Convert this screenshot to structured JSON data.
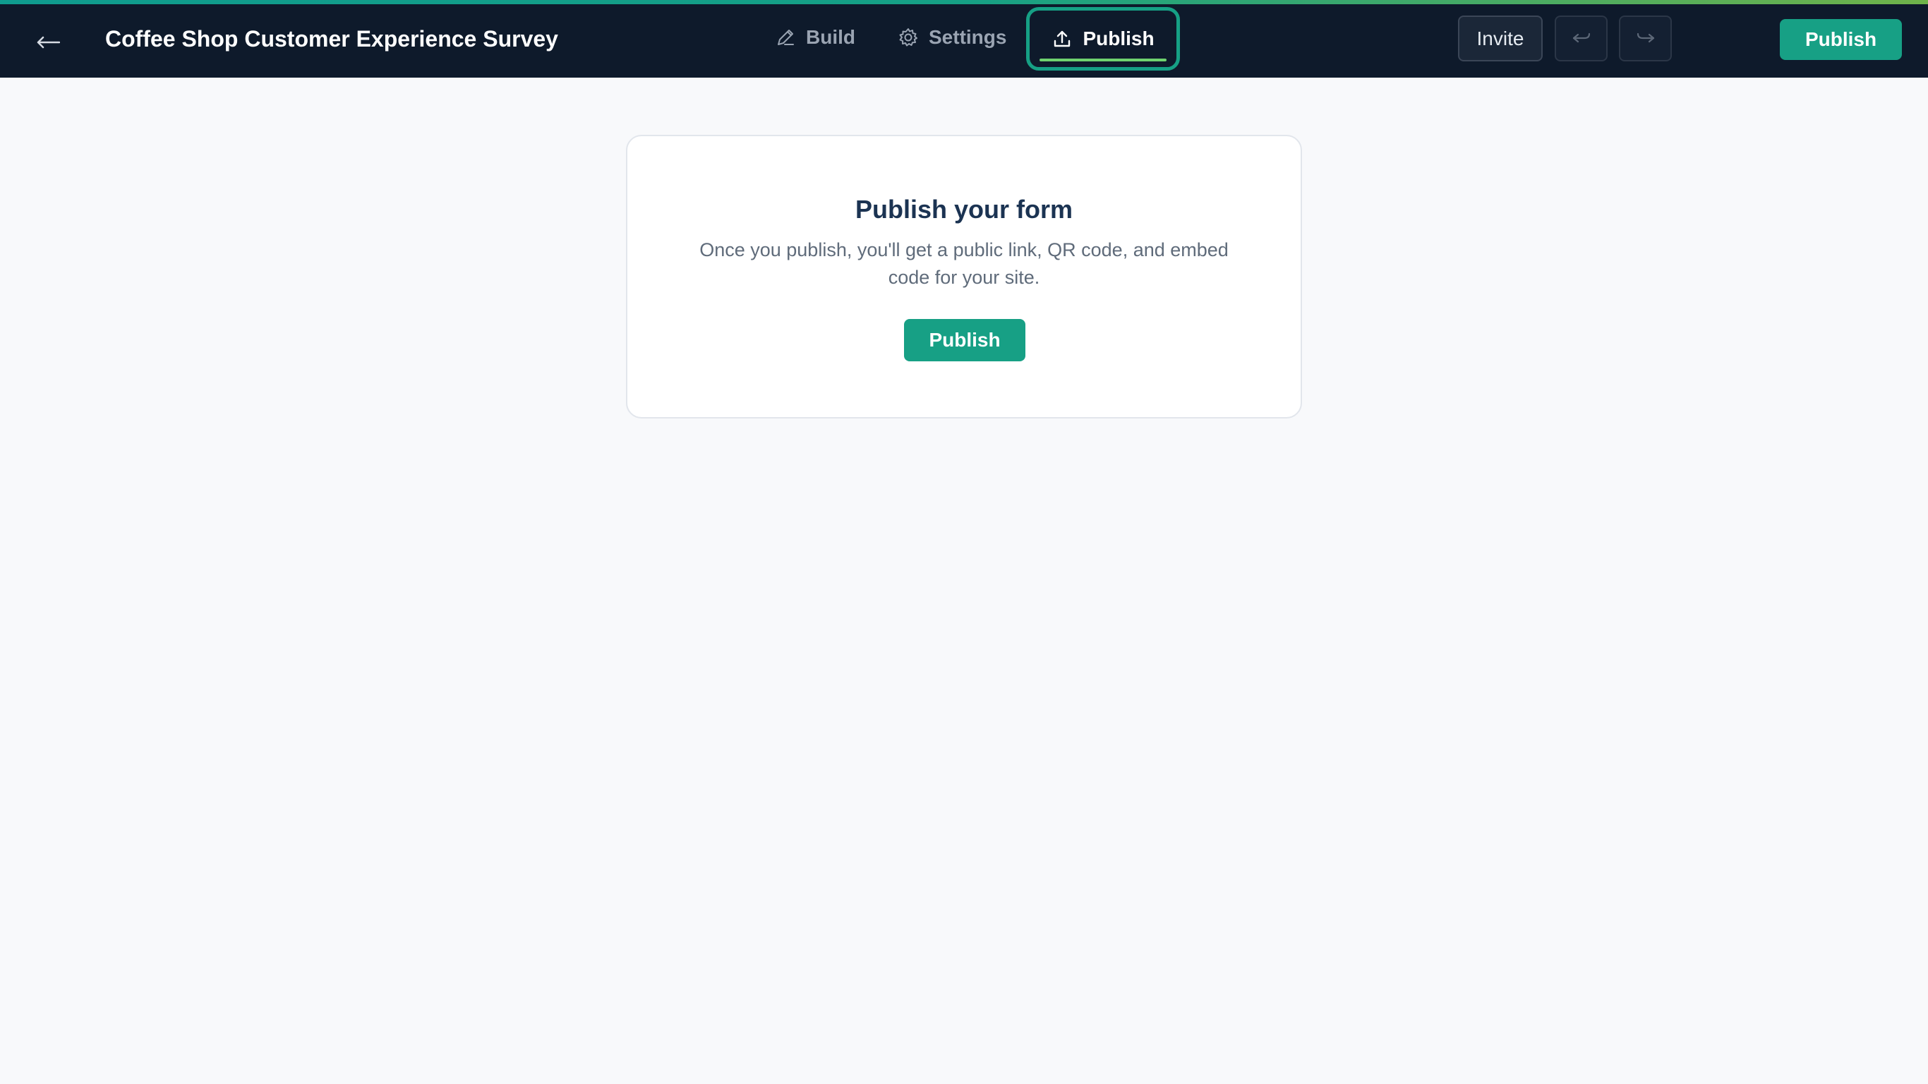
{
  "header": {
    "title": "Coffee Shop Customer Experience Survey",
    "back_icon": "arrow-left-icon",
    "tabs": [
      {
        "label": "Build",
        "icon": "pencil-icon",
        "active": false
      },
      {
        "label": "Settings",
        "icon": "gear-icon",
        "active": false
      },
      {
        "label": "Publish",
        "icon": "upload-icon",
        "active": true
      }
    ],
    "invite_label": "Invite",
    "undo_icon": "undo-icon",
    "redo_icon": "redo-icon",
    "publish_label": "Publish"
  },
  "main": {
    "card": {
      "title": "Publish your form",
      "description": "Once you publish, you'll get a public link, QR code, and embed code for your site.",
      "button_label": "Publish"
    }
  },
  "colors": {
    "header_bg": "#0e1a2b",
    "accent": "#17a085",
    "page_bg": "#f8f9fb",
    "title_text": "#1b3352"
  }
}
